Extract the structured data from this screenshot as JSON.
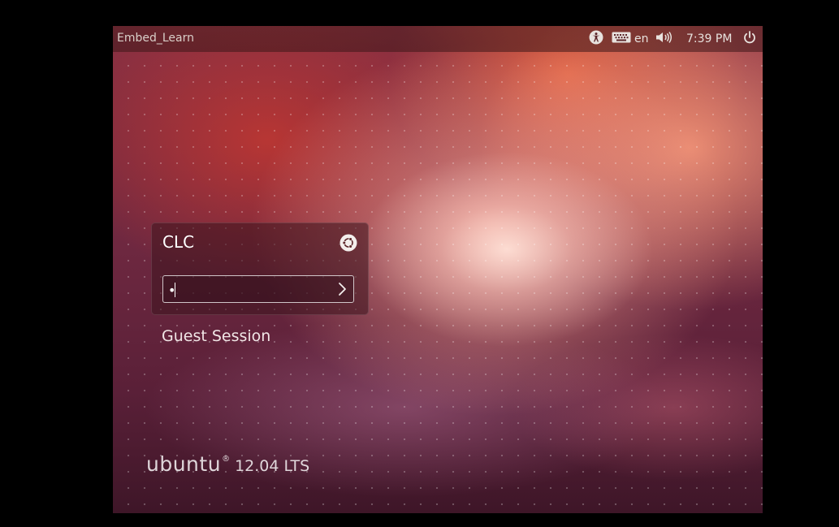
{
  "top_panel": {
    "hostname": "Embed_Learn",
    "keyboard_layout": "en",
    "clock": "7:39 PM",
    "icons": {
      "accessibility": "accessibility-icon",
      "keyboard": "keyboard-icon",
      "volume": "volume-icon",
      "power": "power-icon"
    }
  },
  "greeter": {
    "username": "CLC",
    "session_icon": "ubuntu-session-icon",
    "password_value": "•",
    "submit_icon": "chevron-right-icon"
  },
  "guest_session_label": "Guest Session",
  "branding": {
    "word": "ubuntu",
    "registered_mark": "®",
    "version": "12.04 LTS"
  },
  "colors": {
    "panel_text": "#dfd6d0",
    "accent": "#dd4814",
    "wallpaper_base": "#6e2840"
  }
}
